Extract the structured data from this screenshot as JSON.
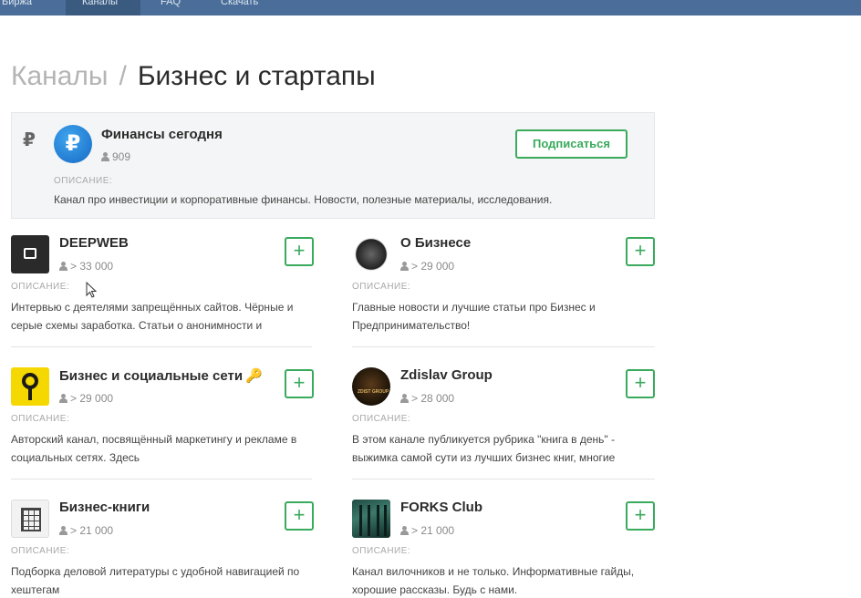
{
  "nav": {
    "tabs": [
      {
        "label": "Биржа"
      },
      {
        "label": "Каналы"
      },
      {
        "label": "FAQ"
      },
      {
        "label": "Скачать"
      }
    ]
  },
  "breadcrumb": {
    "parent": "Каналы",
    "separator": "/",
    "current": "Бизнес и стартапы"
  },
  "featured": {
    "currency_icon": "ruble-icon",
    "avatar_glyph": "₽",
    "title": "Финансы сегодня",
    "subscribers": "909",
    "subscribe_label": "Подписаться",
    "desc_label": "ОПИСАНИЕ:",
    "description": "Канал про инвестиции и корпоративные финансы. Новости, полезные материалы, исследования."
  },
  "channels": [
    {
      "name": "DEEPWEB",
      "subscribers": "> 33 000",
      "desc_label": "ОПИСАНИЕ:",
      "description": "Интервью с деятелями запрещённых сайтов. Чёрные и серые схемы заработка. Статьи о анонимности и",
      "plus": "+"
    },
    {
      "name": "О Бизнесе",
      "subscribers": "> 29 000",
      "desc_label": "ОПИСАНИЕ:",
      "description": "Главные новости и лучшие статьи про Бизнес и Предпринимательство!",
      "plus": "+"
    },
    {
      "name": "Бизнес и социальные сети",
      "name_emoji": "🔑",
      "subscribers": "> 29 000",
      "desc_label": "ОПИСАНИЕ:",
      "description": "Авторский канал, посвящённый маркетингу и рекламе в социальных сетях. Здесь",
      "plus": "+"
    },
    {
      "name": "Zdislav Group",
      "avatar_text": "ZDIST GROUP",
      "subscribers": "> 28 000",
      "desc_label": "ОПИСАНИЕ:",
      "description": "В этом канале публикуется рубрика \"книга в день\" - выжимка самой сути из лучших бизнес книг, многие",
      "plus": "+"
    },
    {
      "name": "Бизнес-книги",
      "subscribers": "> 21 000",
      "desc_label": "ОПИСАНИЕ:",
      "description": "Подборка деловой литературы с удобной навигацией по хештегам",
      "plus": "+"
    },
    {
      "name": "FORKS Club",
      "subscribers": "> 21 000",
      "desc_label": "ОПИСАНИЕ:",
      "description": "Канал вилочников и не только. Информативные гайды, хорошие рассказы. Будь с нами.",
      "plus": "+"
    }
  ],
  "colors": {
    "nav": "#4a6e99",
    "accent_green": "#3aaa5c",
    "featured_bg": "#f4f5f6"
  }
}
